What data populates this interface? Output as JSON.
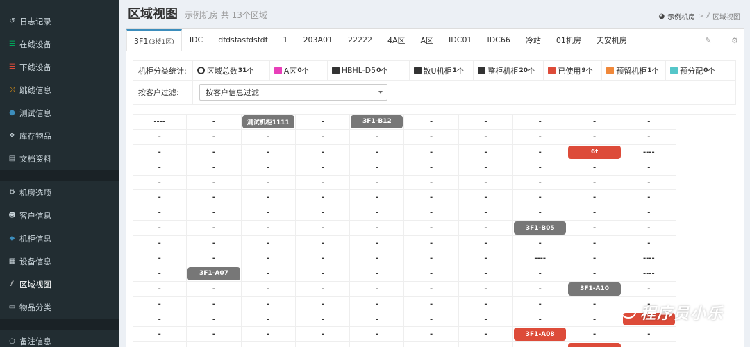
{
  "sidebar": {
    "group1": [
      {
        "label": "日志记录",
        "icon": "history-icon",
        "icon_glyph": "↺",
        "icon_color": "#c9d4da"
      },
      {
        "label": "在线设备",
        "icon": "list-icon",
        "icon_glyph": "☰",
        "icon_color": "#00a65a"
      },
      {
        "label": "下线设备",
        "icon": "list-icon",
        "icon_glyph": "☰",
        "icon_color": "#dd4b39"
      },
      {
        "label": "跳线信息",
        "icon": "shuffle-icon",
        "icon_glyph": "⤨",
        "icon_color": "#f39c12"
      },
      {
        "label": "测试信息",
        "icon": "check-circle-icon",
        "icon_glyph": "●",
        "icon_color": "#3c8dbc"
      },
      {
        "label": "库存物品",
        "icon": "cubes-icon",
        "icon_glyph": "❖",
        "icon_color": "#c9d4da"
      },
      {
        "label": "文档资料",
        "icon": "book-icon",
        "icon_glyph": "▤",
        "icon_color": "#c9d4da"
      }
    ],
    "group2": [
      {
        "label": "机房选项",
        "icon": "cogs-icon",
        "icon_glyph": "⚙",
        "icon_color": "#c9d4da"
      },
      {
        "label": "客户信息",
        "icon": "users-icon",
        "icon_glyph": "☻",
        "icon_color": "#c9d4da"
      },
      {
        "label": "机柜信息",
        "icon": "cube-icon",
        "icon_glyph": "◆",
        "icon_color": "#3c8dbc"
      },
      {
        "label": "设备信息",
        "icon": "server-icon",
        "icon_glyph": "▦",
        "icon_color": "#c9d4da"
      },
      {
        "label": "区域视图",
        "icon": "road-icon",
        "icon_glyph": "⫽",
        "icon_color": "#fff",
        "active": true
      },
      {
        "label": "物品分类",
        "icon": "folder-icon",
        "icon_glyph": "▭",
        "icon_color": "#c9d4da"
      }
    ],
    "group3": [
      {
        "label": "备注信息",
        "icon": "circle-icon",
        "icon_glyph": "○",
        "icon_color": "#c9d4da"
      }
    ]
  },
  "header": {
    "title": "区域视图",
    "subtitle": "示例机房 共 13个区域",
    "breadcrumb_home": "示例机房",
    "breadcrumb_sep": ">",
    "breadcrumb_current": "区域视图"
  },
  "tabs": [
    {
      "label": "3F1",
      "small": "(3楼1区)",
      "active": true
    },
    {
      "label": "IDC"
    },
    {
      "label": "dfdsfasfdsfdf"
    },
    {
      "label": "1"
    },
    {
      "label": "203A01"
    },
    {
      "label": "22222"
    },
    {
      "label": "4A区"
    },
    {
      "label": "A区"
    },
    {
      "label": "IDC01"
    },
    {
      "label": "IDC66"
    },
    {
      "label": "冷站"
    },
    {
      "label": "01机房"
    },
    {
      "label": "天安机房"
    }
  ],
  "stats": {
    "label": "机柜分类统计:",
    "items": [
      {
        "label": "区域总数",
        "count": "31",
        "unit": "个",
        "color": "ring",
        "width": 111
      },
      {
        "label": "A区",
        "count": "0",
        "unit": "个",
        "color": "#e83fb9",
        "width": 83
      },
      {
        "label": "HBHL-D5",
        "count": "0",
        "unit": "个",
        "color": "#333333",
        "width": 118
      },
      {
        "label": "散U机柜",
        "count": "1",
        "unit": "个",
        "color": "#333333",
        "width": 93
      },
      {
        "label": "整柜机柜",
        "count": "20",
        "unit": "个",
        "color": "#333333",
        "width": 101
      },
      {
        "label": "已使用",
        "count": "9",
        "unit": "个",
        "color": "#dd4b39",
        "width": 84
      },
      {
        "label": "预留机柜",
        "count": "1",
        "unit": "个",
        "color": "#f0883a",
        "width": 92
      },
      {
        "label": "预分配",
        "count": "0",
        "unit": "个",
        "color": "#55c6c9",
        "width": 100
      }
    ],
    "filter_label": "按客户过滤:",
    "filter_value": "按客户信息过滤"
  },
  "grid": {
    "columns": 10,
    "rows": [
      [
        {
          "t": "----"
        },
        {
          "t": "-"
        },
        {
          "t": "测试机柜1111",
          "c": "gray"
        },
        {
          "t": "-"
        },
        {
          "t": "3F1-B12",
          "c": "gray"
        },
        {
          "t": "-"
        },
        {
          "t": "-"
        },
        {
          "t": "-"
        },
        {
          "t": "-"
        },
        {
          "t": "-"
        }
      ],
      [
        {
          "t": "-"
        },
        {
          "t": "-"
        },
        {
          "t": "-"
        },
        {
          "t": "-"
        },
        {
          "t": "-"
        },
        {
          "t": "-"
        },
        {
          "t": "-"
        },
        {
          "t": "-"
        },
        {
          "t": "-"
        },
        {
          "t": "-"
        }
      ],
      [
        {
          "t": "-"
        },
        {
          "t": "-"
        },
        {
          "t": "-"
        },
        {
          "t": "-"
        },
        {
          "t": "-"
        },
        {
          "t": "-"
        },
        {
          "t": "-"
        },
        {
          "t": "-"
        },
        {
          "t": "6f",
          "c": "red"
        },
        {
          "t": "----"
        }
      ],
      [
        {
          "t": "-"
        },
        {
          "t": "-"
        },
        {
          "t": "-"
        },
        {
          "t": "-"
        },
        {
          "t": "-"
        },
        {
          "t": "-"
        },
        {
          "t": "-"
        },
        {
          "t": "-"
        },
        {
          "t": "-"
        },
        {
          "t": "-"
        }
      ],
      [
        {
          "t": "-"
        },
        {
          "t": "-"
        },
        {
          "t": "-"
        },
        {
          "t": "-"
        },
        {
          "t": "-"
        },
        {
          "t": "-"
        },
        {
          "t": "-"
        },
        {
          "t": "-"
        },
        {
          "t": "-"
        },
        {
          "t": "-"
        }
      ],
      [
        {
          "t": "-"
        },
        {
          "t": "-"
        },
        {
          "t": "-"
        },
        {
          "t": "-"
        },
        {
          "t": "-"
        },
        {
          "t": "-"
        },
        {
          "t": "-"
        },
        {
          "t": "-"
        },
        {
          "t": "-"
        },
        {
          "t": "-"
        }
      ],
      [
        {
          "t": "-"
        },
        {
          "t": "-"
        },
        {
          "t": "-"
        },
        {
          "t": "-"
        },
        {
          "t": "-"
        },
        {
          "t": "-"
        },
        {
          "t": "-"
        },
        {
          "t": "-"
        },
        {
          "t": "-"
        },
        {
          "t": "-"
        }
      ],
      [
        {
          "t": "-"
        },
        {
          "t": "-"
        },
        {
          "t": "-"
        },
        {
          "t": "-"
        },
        {
          "t": "-"
        },
        {
          "t": "-"
        },
        {
          "t": "-"
        },
        {
          "t": "3F1-B05",
          "c": "gray"
        },
        {
          "t": "-"
        },
        {
          "t": "-"
        }
      ],
      [
        {
          "t": "-"
        },
        {
          "t": "-"
        },
        {
          "t": "-"
        },
        {
          "t": "-"
        },
        {
          "t": "-"
        },
        {
          "t": "-"
        },
        {
          "t": "-"
        },
        {
          "t": "-"
        },
        {
          "t": "-"
        },
        {
          "t": "-"
        }
      ],
      [
        {
          "t": "-"
        },
        {
          "t": "-"
        },
        {
          "t": "-"
        },
        {
          "t": "-"
        },
        {
          "t": "-"
        },
        {
          "t": "-"
        },
        {
          "t": "-"
        },
        {
          "t": "----"
        },
        {
          "t": "-"
        },
        {
          "t": "----"
        }
      ],
      [
        {
          "t": "-"
        },
        {
          "t": "3F1-A07",
          "c": "gray"
        },
        {
          "t": "-"
        },
        {
          "t": "-"
        },
        {
          "t": "-"
        },
        {
          "t": "-"
        },
        {
          "t": "-"
        },
        {
          "t": "-"
        },
        {
          "t": "-"
        },
        {
          "t": "----"
        }
      ],
      [
        {
          "t": "-"
        },
        {
          "t": "-"
        },
        {
          "t": "-"
        },
        {
          "t": "-"
        },
        {
          "t": "-"
        },
        {
          "t": "-"
        },
        {
          "t": "-"
        },
        {
          "t": "-"
        },
        {
          "t": "3F1-A10",
          "c": "gray"
        },
        {
          "t": "-"
        }
      ],
      [
        {
          "t": "-"
        },
        {
          "t": "-"
        },
        {
          "t": "-"
        },
        {
          "t": "-"
        },
        {
          "t": "-"
        },
        {
          "t": "-"
        },
        {
          "t": "-"
        },
        {
          "t": "-"
        },
        {
          "t": "-"
        },
        {
          "t": "-"
        }
      ],
      [
        {
          "t": "-"
        },
        {
          "t": "-"
        },
        {
          "t": "-"
        },
        {
          "t": "-"
        },
        {
          "t": "-"
        },
        {
          "t": "-"
        },
        {
          "t": "-"
        },
        {
          "t": "-"
        },
        {
          "t": "-"
        },
        {
          "t": "-",
          "c": "red"
        }
      ],
      [
        {
          "t": "-"
        },
        {
          "t": "-"
        },
        {
          "t": "-"
        },
        {
          "t": "-"
        },
        {
          "t": "-"
        },
        {
          "t": "-"
        },
        {
          "t": "-"
        },
        {
          "t": "3F1-A08",
          "c": "red"
        },
        {
          "t": "-"
        },
        {
          "t": "-"
        }
      ],
      [
        {
          "t": "-"
        },
        {
          "t": "-"
        },
        {
          "t": "-"
        },
        {
          "t": "-"
        },
        {
          "t": "-"
        },
        {
          "t": "-"
        },
        {
          "t": "-"
        },
        {
          "t": "-"
        },
        {
          "t": "",
          "c": "red"
        },
        {
          "t": "-"
        }
      ]
    ]
  },
  "watermark": "程序员小乐"
}
